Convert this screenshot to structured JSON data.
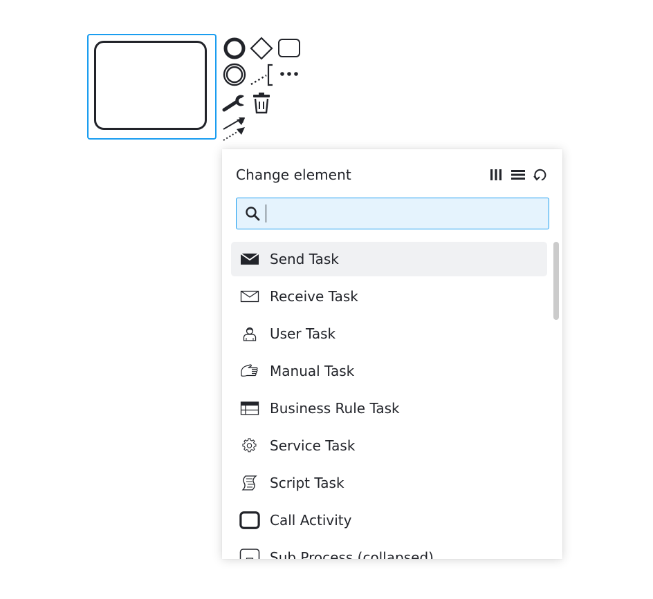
{
  "canvas": {
    "selected_element": {
      "type": "task",
      "selection_color": "#1a9df0"
    },
    "context_pad": {
      "entries": [
        {
          "name": "append-end-event",
          "icon": "end-event-icon",
          "title": "Append end event"
        },
        {
          "name": "append-gateway",
          "icon": "gateway-icon",
          "title": "Append gateway"
        },
        {
          "name": "append-task",
          "icon": "task-icon",
          "title": "Append task"
        },
        {
          "name": "append-intermediate-event",
          "icon": "intermediate-event-icon",
          "title": "Append intermediate/boundary event"
        },
        {
          "name": "append-text-annotation",
          "icon": "text-annotation-icon",
          "title": "Add text annotation"
        },
        {
          "name": "more-append",
          "icon": "more-icon",
          "title": "Append element"
        },
        {
          "name": "replace",
          "icon": "wrench-icon",
          "title": "Change element"
        },
        {
          "name": "delete",
          "icon": "trash-icon",
          "title": "Delete"
        },
        {
          "name": "connect",
          "icon": "connection-icon",
          "title": "Connect using sequence flow or association"
        }
      ]
    }
  },
  "popup": {
    "title": "Change element",
    "header_entries": [
      {
        "name": "toggle-parallel-multi-instance",
        "icon": "parallel-mi-icon",
        "title": "Parallel multi-instance"
      },
      {
        "name": "toggle-sequential-multi-instance",
        "icon": "sequential-mi-icon",
        "title": "Sequential multi-instance"
      },
      {
        "name": "toggle-loop",
        "icon": "loop-icon",
        "title": "Loop"
      }
    ],
    "search": {
      "value": "",
      "placeholder": ""
    },
    "colors": {
      "search_bg": "#e5f3fd",
      "search_border": "#1a9df0",
      "active_item_bg": "#f0f1f3",
      "text": "#22242a"
    },
    "items": [
      {
        "label": "Send Task",
        "icon": "send-task-icon",
        "active": true
      },
      {
        "label": "Receive Task",
        "icon": "receive-task-icon",
        "active": false
      },
      {
        "label": "User Task",
        "icon": "user-task-icon",
        "active": false
      },
      {
        "label": "Manual Task",
        "icon": "manual-task-icon",
        "active": false
      },
      {
        "label": "Business Rule Task",
        "icon": "business-rule-task-icon",
        "active": false
      },
      {
        "label": "Service Task",
        "icon": "service-task-icon",
        "active": false
      },
      {
        "label": "Script Task",
        "icon": "script-task-icon",
        "active": false
      },
      {
        "label": "Call Activity",
        "icon": "call-activity-icon",
        "active": false
      },
      {
        "label": "Sub Process (collapsed)",
        "icon": "subprocess-collapsed-icon",
        "active": false
      }
    ]
  }
}
